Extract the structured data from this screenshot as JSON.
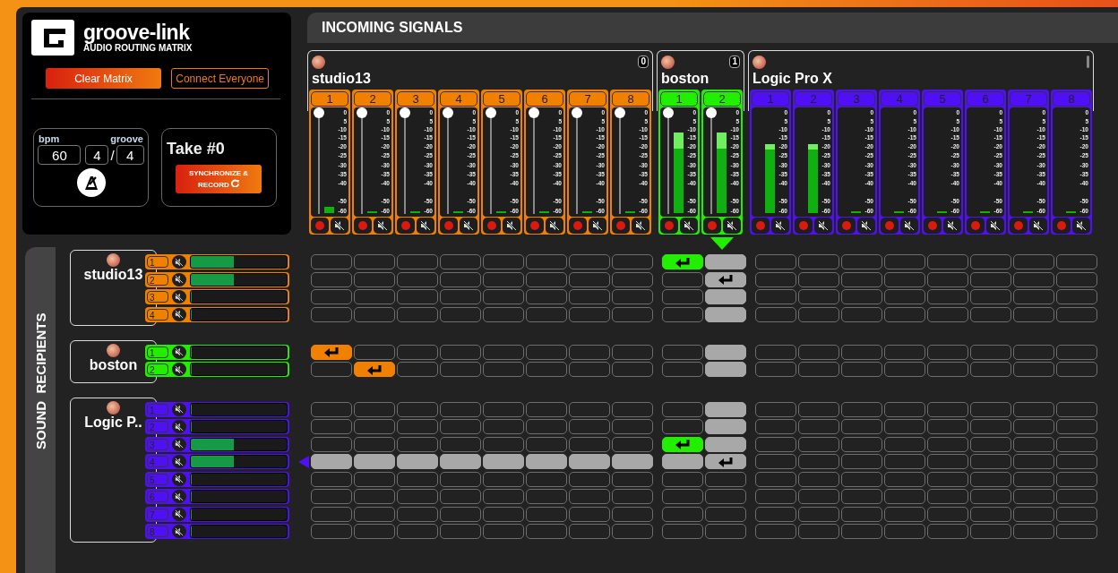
{
  "brand": {
    "title": "groove-link",
    "subtitle": "AUDIO ROUTING MATRIX"
  },
  "actions": {
    "clear": "Clear Matrix",
    "connect": "Connect Everyone"
  },
  "tempo": {
    "bpm_label": "bpm",
    "groove_label": "groove",
    "bpm": "60",
    "numerator": "4",
    "separator": "/",
    "denominator": "4"
  },
  "take": {
    "title": "Take #0",
    "record_button": "SYNCHRONIZE & RECORD"
  },
  "incoming": {
    "title": "INCOMING SIGNALS"
  },
  "sources": [
    {
      "name": "studio13",
      "badge": "0",
      "color": "#f08000",
      "channels": [
        {
          "label": "1",
          "level": 0.06,
          "hovered": false,
          "fader": {
            "level": 1
          },
          "scale": [
            "0",
            "5",
            "-10",
            "-15",
            "-20",
            "-25",
            "-30",
            "-35",
            "-40",
            "-50",
            "-60"
          ]
        },
        {
          "label": "2",
          "level": 0.02,
          "hovered": false,
          "fader": {
            "level": 1
          },
          "scale": [
            "0",
            "5",
            "-10",
            "-15",
            "-20",
            "-25",
            "-30",
            "-35",
            "-40",
            "-50",
            "-60"
          ]
        },
        {
          "label": "3",
          "level": 0.02,
          "hovered": false,
          "fader": {
            "level": 1
          },
          "scale": [
            "0",
            "5",
            "-10",
            "-15",
            "-20",
            "-25",
            "-30",
            "-35",
            "-40",
            "-50",
            "-60"
          ]
        },
        {
          "label": "4",
          "level": 0.02,
          "hovered": false,
          "fader": {
            "level": 1
          },
          "scale": [
            "0",
            "5",
            "-10",
            "-15",
            "-20",
            "-25",
            "-30",
            "-35",
            "-40",
            "-50",
            "-60"
          ]
        },
        {
          "label": "5",
          "level": 0.02,
          "hovered": false,
          "fader": {
            "level": 1
          },
          "scale": [
            "0",
            "5",
            "-10",
            "-15",
            "-20",
            "-25",
            "-30",
            "-35",
            "-40",
            "-50",
            "-60"
          ]
        },
        {
          "label": "6",
          "level": 0.02,
          "hovered": false,
          "fader": {
            "level": 1
          },
          "scale": [
            "0",
            "5",
            "-10",
            "-15",
            "-20",
            "-25",
            "-30",
            "-35",
            "-40",
            "-50",
            "-60"
          ]
        },
        {
          "label": "7",
          "level": 0.02,
          "hovered": false,
          "fader": {
            "level": 1
          },
          "scale": [
            "0",
            "5",
            "-10",
            "-15",
            "-20",
            "-25",
            "-30",
            "-35",
            "-40",
            "-50",
            "-60"
          ]
        },
        {
          "label": "8",
          "level": 0.02,
          "hovered": false,
          "fader": {
            "level": 1
          },
          "scale": [
            "0",
            "5",
            "-10",
            "-15",
            "-20",
            "-25",
            "-30",
            "-35",
            "-40",
            "-50",
            "-60"
          ]
        }
      ]
    },
    {
      "name": "boston",
      "badge": "1",
      "color": "#22ee00",
      "channels": [
        {
          "label": "1",
          "level": 0.64,
          "peak": {
            "level": 0.8
          },
          "hovered": false,
          "fader": {
            "level": 1
          },
          "scale": [
            "0",
            "5",
            "-10",
            "-15",
            "-20",
            "-25",
            "-30",
            "-35",
            "-40",
            "-50",
            "-60"
          ]
        },
        {
          "label": "2",
          "level": 0.64,
          "peak": {
            "level": 0.8
          },
          "hovered": true,
          "fader": {
            "level": 1
          },
          "scale": [
            "0",
            "5",
            "-10",
            "-15",
            "-20",
            "-25",
            "-30",
            "-35",
            "-40",
            "-50",
            "-60"
          ]
        }
      ]
    },
    {
      "name": "Logic Pro X",
      "color": "#5010f5",
      "channels": [
        {
          "label": "1",
          "level": 0.63,
          "peak": {
            "level": 0.69
          },
          "hovered": false,
          "scale": [
            "0",
            "5",
            "-10",
            "-15",
            "-20",
            "-25",
            "-30",
            "-35",
            "-40",
            "-50",
            "-60"
          ]
        },
        {
          "label": "2",
          "level": 0.63,
          "peak": {
            "level": 0.69
          },
          "hovered": false,
          "scale": [
            "0",
            "5",
            "-10",
            "-15",
            "-20",
            "-25",
            "-30",
            "-35",
            "-40",
            "-50",
            "-60"
          ]
        },
        {
          "label": "3",
          "level": 0.02,
          "hovered": false,
          "scale": [
            "0",
            "5",
            "-10",
            "-15",
            "-20",
            "-25",
            "-30",
            "-35",
            "-40",
            "-50",
            "-60"
          ]
        },
        {
          "label": "4",
          "level": 0.02,
          "hovered": false,
          "scale": [
            "0",
            "5",
            "-10",
            "-15",
            "-20",
            "-25",
            "-30",
            "-35",
            "-40",
            "-50",
            "-60"
          ]
        },
        {
          "label": "5",
          "level": 0.02,
          "hovered": false,
          "scale": [
            "0",
            "5",
            "-10",
            "-15",
            "-20",
            "-25",
            "-30",
            "-35",
            "-40",
            "-50",
            "-60"
          ]
        },
        {
          "label": "6",
          "level": 0.02,
          "hovered": false,
          "scale": [
            "0",
            "5",
            "-10",
            "-15",
            "-20",
            "-25",
            "-30",
            "-35",
            "-40",
            "-50",
            "-60"
          ]
        },
        {
          "label": "7",
          "level": 0.02,
          "hovered": false,
          "scale": [
            "0",
            "5",
            "-10",
            "-15",
            "-20",
            "-25",
            "-30",
            "-35",
            "-40",
            "-50",
            "-60"
          ]
        },
        {
          "label": "8",
          "level": 0.02,
          "hovered": false,
          "scale": [
            "0",
            "5",
            "-10",
            "-15",
            "-20",
            "-25",
            "-30",
            "-35",
            "-40",
            "-50",
            "-60"
          ]
        }
      ]
    }
  ],
  "recipients_tab": "SOUND  RECIPIENTS",
  "recipients": [
    {
      "name": "studio13",
      "color": "#f08000",
      "outputs": [
        {
          "label": "1",
          "level": 0.45,
          "hovered": false,
          "routes": [
            false,
            false,
            false,
            false,
            false,
            false,
            false,
            false,
            true,
            false,
            false,
            false,
            false,
            false,
            false,
            false,
            false,
            false
          ]
        },
        {
          "label": "2",
          "level": 0.45,
          "hovered": false,
          "routes": [
            false,
            false,
            false,
            false,
            false,
            false,
            false,
            false,
            false,
            true,
            false,
            false,
            false,
            false,
            false,
            false,
            false,
            false
          ]
        },
        {
          "label": "3",
          "level": 0,
          "hovered": false,
          "routes": [
            false,
            false,
            false,
            false,
            false,
            false,
            false,
            false,
            false,
            false,
            false,
            false,
            false,
            false,
            false,
            false,
            false,
            false
          ]
        },
        {
          "label": "4",
          "level": 0,
          "hovered": false,
          "routes": [
            false,
            false,
            false,
            false,
            false,
            false,
            false,
            false,
            false,
            false,
            false,
            false,
            false,
            false,
            false,
            false,
            false,
            false
          ]
        }
      ]
    },
    {
      "name": "boston",
      "color": "#22ee00",
      "outputs": [
        {
          "label": "1",
          "level": 0,
          "hovered": false,
          "routes": [
            true,
            false,
            false,
            false,
            false,
            false,
            false,
            false,
            false,
            false,
            false,
            false,
            false,
            false,
            false,
            false,
            false,
            false
          ]
        },
        {
          "label": "2",
          "level": 0,
          "hovered": false,
          "routes": [
            false,
            true,
            false,
            false,
            false,
            false,
            false,
            false,
            false,
            false,
            false,
            false,
            false,
            false,
            false,
            false,
            false,
            false
          ]
        }
      ]
    },
    {
      "name": "Logic P..",
      "color": "#5010f5",
      "outputs": [
        {
          "label": "1",
          "level": 0,
          "hovered": false,
          "routes": [
            false,
            false,
            false,
            false,
            false,
            false,
            false,
            false,
            false,
            false,
            false,
            false,
            false,
            false,
            false,
            false,
            false,
            false
          ]
        },
        {
          "label": "2",
          "level": 0,
          "hovered": false,
          "routes": [
            false,
            false,
            false,
            false,
            false,
            false,
            false,
            false,
            false,
            false,
            false,
            false,
            false,
            false,
            false,
            false,
            false,
            false
          ]
        },
        {
          "label": "3",
          "level": 0.45,
          "hovered": false,
          "routes": [
            false,
            false,
            false,
            false,
            false,
            false,
            false,
            false,
            true,
            false,
            false,
            false,
            false,
            false,
            false,
            false,
            false,
            false
          ]
        },
        {
          "label": "4",
          "level": 0.45,
          "hovered": true,
          "routes": [
            false,
            false,
            false,
            false,
            false,
            false,
            false,
            false,
            false,
            true,
            false,
            false,
            false,
            false,
            false,
            false,
            false,
            false
          ]
        },
        {
          "label": "5",
          "level": 0,
          "hovered": false,
          "routes": [
            false,
            false,
            false,
            false,
            false,
            false,
            false,
            false,
            false,
            false,
            false,
            false,
            false,
            false,
            false,
            false,
            false,
            false
          ]
        },
        {
          "label": "6",
          "level": 0,
          "hovered": false,
          "routes": [
            false,
            false,
            false,
            false,
            false,
            false,
            false,
            false,
            false,
            false,
            false,
            false,
            false,
            false,
            false,
            false,
            false,
            false
          ]
        },
        {
          "label": "7",
          "level": 0,
          "hovered": false,
          "routes": [
            false,
            false,
            false,
            false,
            false,
            false,
            false,
            false,
            false,
            false,
            false,
            false,
            false,
            false,
            false,
            false,
            false,
            false
          ]
        },
        {
          "label": "8",
          "level": 0,
          "hovered": false,
          "routes": [
            false,
            false,
            false,
            false,
            false,
            false,
            false,
            false,
            false,
            false,
            false,
            false,
            false,
            false,
            false,
            false,
            false,
            false
          ]
        }
      ]
    }
  ]
}
